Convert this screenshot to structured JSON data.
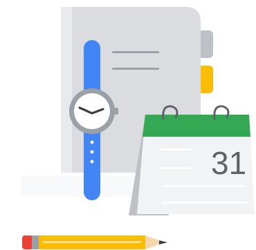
{
  "illustration": {
    "calendar": {
      "date_number": "31"
    },
    "colors": {
      "notebook_cover": "#dadce0",
      "notebook_spine": "#e8eaed",
      "tab_gray": "#bdc1c6",
      "tab_yellow": "#fbbc04",
      "watch_strap": "#4285f4",
      "watch_face": "#ffffff",
      "watch_bezel": "#9aa0a6",
      "calendar_header": "#34a853",
      "calendar_body": "#f1f3f4",
      "pencil_body": "#fbbc04",
      "pencil_eraser": "#ea4335",
      "line_gray": "#9aa0a6"
    },
    "icons": [
      "notebook-icon",
      "wristwatch-icon",
      "calendar-icon",
      "pencil-icon"
    ]
  }
}
